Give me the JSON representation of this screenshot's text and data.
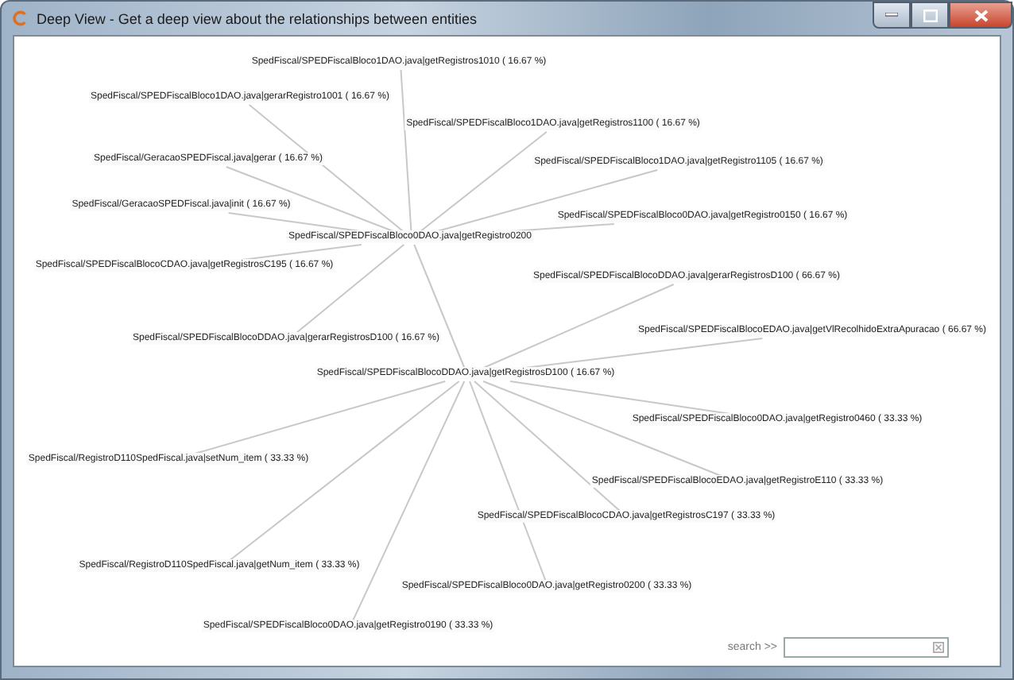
{
  "window": {
    "title": "Deep View - Get a deep view about the relationships between entities"
  },
  "graph": {
    "root": {
      "label": "SpedFiscal/SPEDFiscalBloco0DAO.java|getRegistro0200",
      "children": [
        {
          "label": "SpedFiscal/SPEDFiscalBloco1DAO.java|getRegistros1010 ( 16.67 %)"
        },
        {
          "label": "SpedFiscal/SPEDFiscalBloco1DAO.java|gerarRegistro1001 ( 16.67 %)"
        },
        {
          "label": "SpedFiscal/SPEDFiscalBloco1DAO.java|getRegistros1100 ( 16.67 %)"
        },
        {
          "label": "SpedFiscal/GeracaoSPEDFiscal.java|gerar ( 16.67 %)"
        },
        {
          "label": "SpedFiscal/SPEDFiscalBloco1DAO.java|getRegistro1105 ( 16.67 %)"
        },
        {
          "label": "SpedFiscal/GeracaoSPEDFiscal.java|init ( 16.67 %)"
        },
        {
          "label": "SpedFiscal/SPEDFiscalBloco0DAO.java|getRegistro0150 ( 16.67 %)"
        },
        {
          "label": "SpedFiscal/SPEDFiscalBlocoCDAO.java|getRegistrosC195 ( 16.67 %)"
        },
        {
          "label": "SpedFiscal/SPEDFiscalBlocoDDAO.java|gerarRegistrosD100 ( 16.67 %)"
        },
        {
          "label": "SpedFiscal/SPEDFiscalBlocoDDAO.java|getRegistrosD100 ( 16.67 %)",
          "children": [
            {
              "label": "SpedFiscal/SPEDFiscalBlocoDDAO.java|gerarRegistrosD100 ( 66.67 %)"
            },
            {
              "label": "SpedFiscal/SPEDFiscalBlocoEDAO.java|getVlRecolhidoExtraApuracao ( 66.67 %)"
            },
            {
              "label": "SpedFiscal/SPEDFiscalBloco0DAO.java|getRegistro0460 ( 33.33 %)"
            },
            {
              "label": "SpedFiscal/SPEDFiscalBlocoEDAO.java|getRegistroE110 ( 33.33 %)"
            },
            {
              "label": "SpedFiscal/SPEDFiscalBlocoCDAO.java|getRegistrosC197 ( 33.33 %)"
            },
            {
              "label": "SpedFiscal/SPEDFiscalBloco0DAO.java|getRegistro0200 ( 33.33 %)"
            },
            {
              "label": "SpedFiscal/SPEDFiscalBloco0DAO.java|getRegistro0190 ( 33.33 %)"
            },
            {
              "label": "SpedFiscal/RegistroD110SpedFiscal.java|setNum_item ( 33.33 %)"
            },
            {
              "label": "SpedFiscal/RegistroD110SpedFiscal.java|getNum_item ( 33.33 %)"
            }
          ]
        }
      ]
    }
  },
  "search": {
    "label": "search >>"
  }
}
